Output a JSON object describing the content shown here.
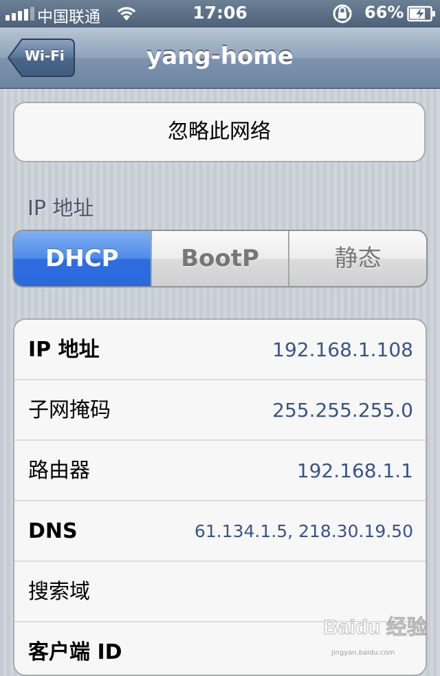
{
  "status_bar": {
    "carrier": "中国联通",
    "time": "17:06",
    "battery": "66%",
    "icons": [
      "signal-icon",
      "wifi-icon",
      "rotation-lock-icon",
      "battery-charging-icon"
    ]
  },
  "nav": {
    "back_label": "Wi-Fi",
    "title": "yang-home"
  },
  "forget_button": "忽略此网络",
  "ip_section_header": "IP 地址",
  "segments": [
    {
      "label": "DHCP",
      "selected": true
    },
    {
      "label": "BootP",
      "selected": false
    },
    {
      "label": "静态",
      "selected": false
    }
  ],
  "rows": [
    {
      "label": "IP 地址",
      "value": "192.168.1.108"
    },
    {
      "label": "子网掩码",
      "value": "255.255.255.0"
    },
    {
      "label": "路由器",
      "value": "192.168.1.1"
    },
    {
      "label": "DNS",
      "value": "61.134.1.5, 218.30.19.50"
    },
    {
      "label": "搜索域",
      "value": ""
    },
    {
      "label": "客户端 ID",
      "value": ""
    }
  ],
  "watermark": {
    "brand": "Baidu 经验",
    "url": "jingyan.baidu.com"
  },
  "colors": {
    "selected_segment": "#2f6ee0",
    "value_text": "#385487",
    "nav_bar": "#7d93ae"
  }
}
